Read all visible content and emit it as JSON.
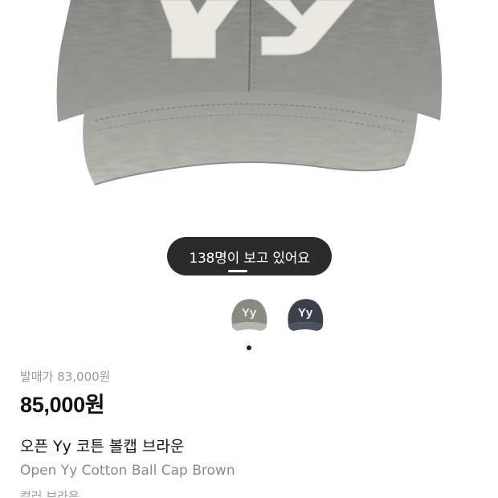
{
  "product_image": {
    "logo_text": "Yy",
    "colors": {
      "denim_gray": "#8c8c87",
      "denim_dark": "#5f605c",
      "patch": "#e9e9e2"
    }
  },
  "viewer_badge": {
    "text": "138명이 보고 있어요"
  },
  "thumbnails": [
    {
      "label": "Yy",
      "color_name": "brown-gray",
      "hex": "#8a8a84"
    },
    {
      "label": "Yy",
      "color_name": "navy",
      "hex": "#3b3f4c"
    }
  ],
  "product": {
    "release_price": "발매가 83,000원",
    "price": "85,000원",
    "name_ko": "오픈 Yy 코튼 볼캡 브라운",
    "name_en": "Open Yy Cotton Ball Cap Brown",
    "next_line": "컬러 브라운"
  }
}
